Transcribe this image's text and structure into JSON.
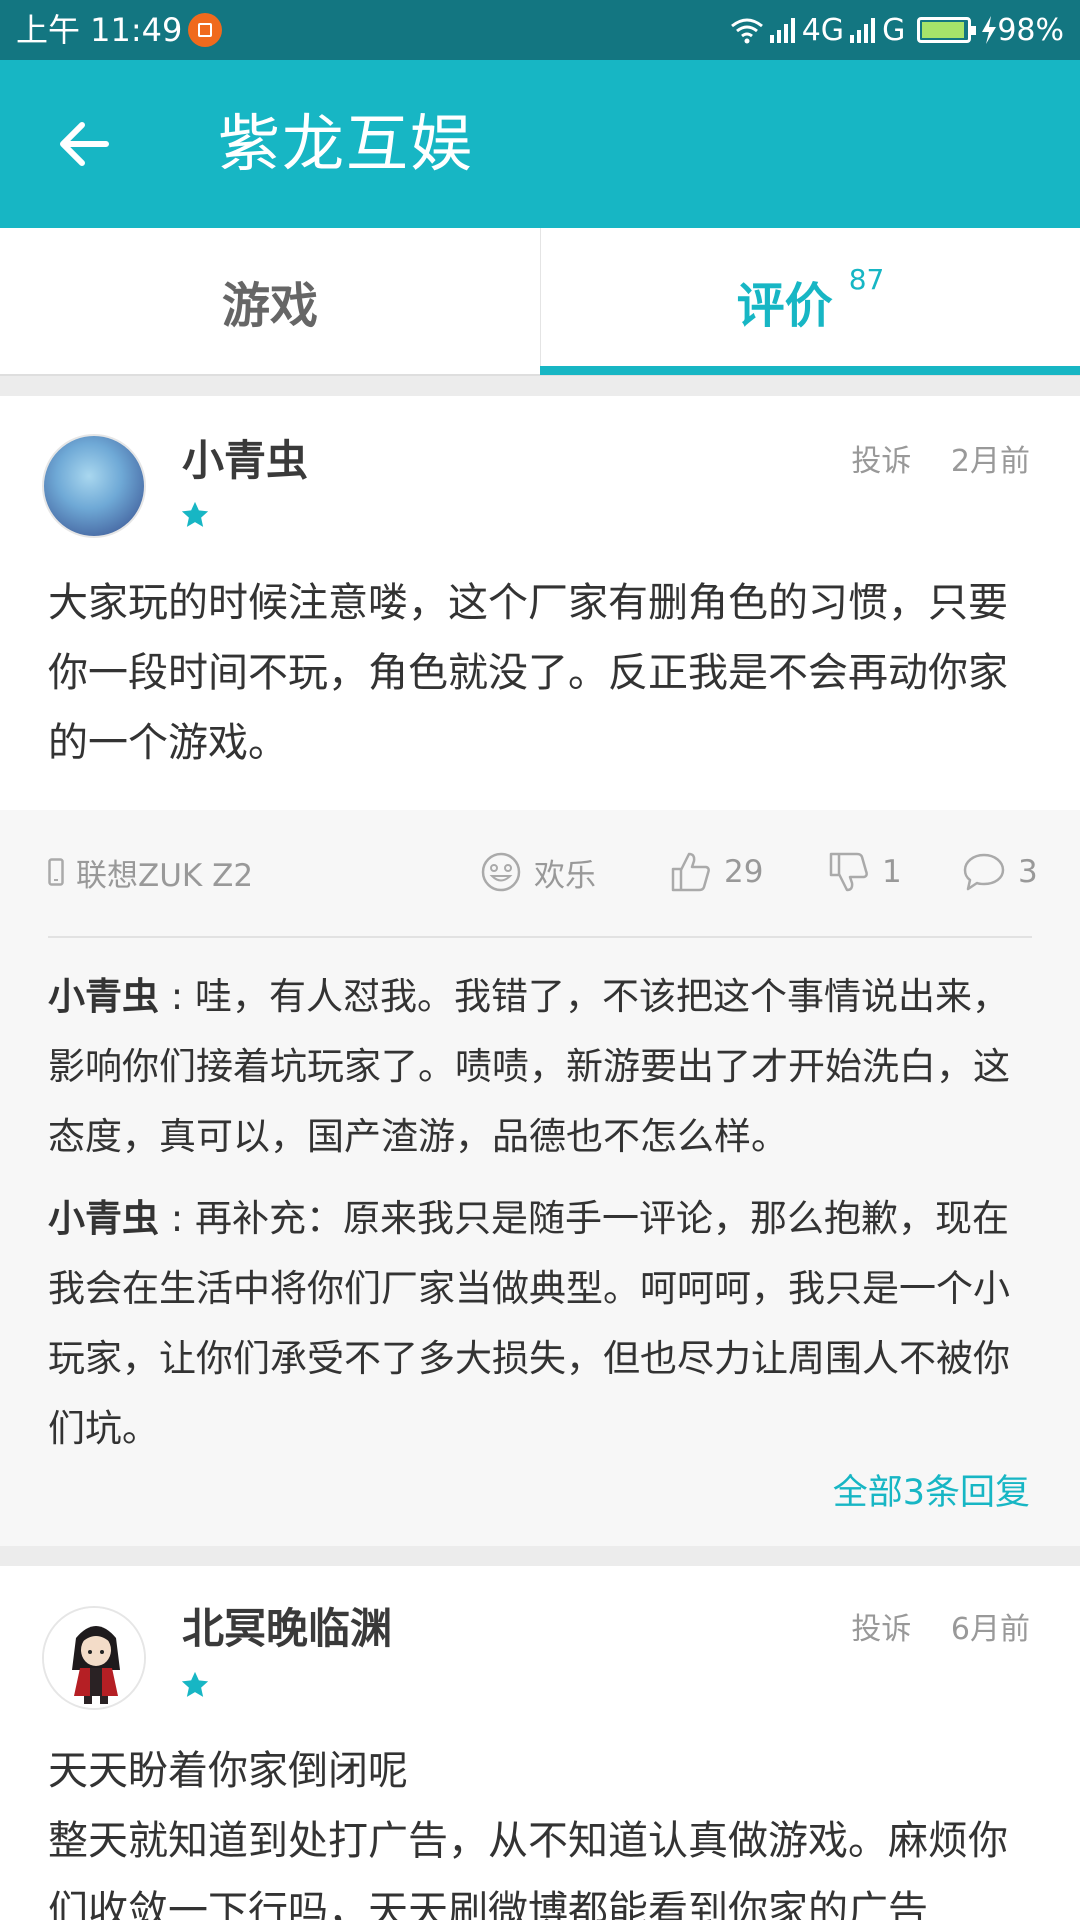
{
  "status_bar": {
    "time": "上午 11:49",
    "network": "4G",
    "network2": "G",
    "battery": "98%"
  },
  "app_bar": {
    "title": "紫龙互娱"
  },
  "tabs": [
    {
      "label": "游戏"
    },
    {
      "label": "评价",
      "count": "87"
    }
  ],
  "reviews": [
    {
      "username": "小青虫",
      "report": "投诉",
      "time": "2月前",
      "text": "大家玩的时候注意喽，这个厂家有删角色的习惯，只要你一段时间不玩，角色就没了。反正我是不会再动你家的一个游戏。",
      "device": "联想ZUK Z2",
      "mood": "欢乐",
      "likes": "29",
      "dislikes": "1",
      "comments": "3",
      "replies": [
        {
          "name": "小青虫",
          "sep": " : ",
          "text": "哇，有人怼我。我错了，不该把这个事情说出来，影响你们接着坑玩家了。啧啧，新游要出了才开始洗白，这态度，真可以，国产渣游，品德也不怎么样。"
        },
        {
          "name": "小青虫",
          "sep": " : ",
          "text": "再补充：原来我只是随手一评论，那么抱歉，现在我会在生活中将你们厂家当做典型。呵呵呵，我只是一个小玩家，让你们承受不了多大损失，但也尽力让周围人不被你们坑。"
        }
      ],
      "all_replies": "全部3条回复"
    },
    {
      "username": "北冥晚临渊",
      "report": "投诉",
      "time": "6月前",
      "text_line1": "天天盼着你家倒闭呢",
      "text_line2": "整天就知道到处打广告，从不知道认真做游戏。麻烦你们收敛一下行吗，天天刷微博都能看到你家的广告"
    }
  ],
  "colors": {
    "status_bar": "#137681",
    "accent": "#17b6c4"
  }
}
